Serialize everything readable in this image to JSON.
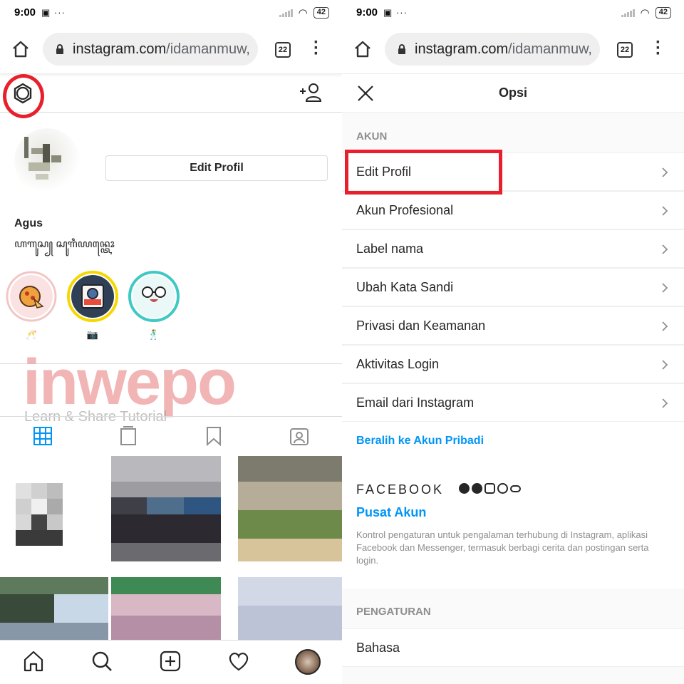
{
  "status_bar": {
    "time": "9:00",
    "battery": "42"
  },
  "browser": {
    "url_main": "instagram.com",
    "url_path": "/idamanmuw,",
    "tab_count": "22"
  },
  "profile": {
    "edit_button": "Edit Profil",
    "username": "Agus",
    "bio": "ꦲꦒꦸꦱ꧀ ꦱꦸꦒꦶꦪꦤ꧀ꦠꦺꦴ",
    "highlights": [
      {
        "label": "🥂",
        "ring": "#f3c6c6",
        "icon": "pizza-icon"
      },
      {
        "label": "📷",
        "ring": "#f5d800",
        "icon": "camera-icon"
      },
      {
        "label": "🕺",
        "ring": "#3fc9c4",
        "icon": "glasses-face-icon"
      }
    ]
  },
  "watermark": {
    "brand": "inwepo",
    "tagline": "Learn & Share Tutorial"
  },
  "options": {
    "title": "Opsi",
    "section_account": "AKUN",
    "account_items": [
      "Edit Profil",
      "Akun Profesional",
      "Label nama",
      "Ubah Kata Sandi",
      "Privasi dan Keamanan",
      "Aktivitas Login",
      "Email dari Instagram"
    ],
    "switch_link": "Beralih ke Akun Pribadi",
    "facebook_word": "FACEBOOK",
    "accounts_center": "Pusat Akun",
    "accounts_center_desc": "Kontrol pengaturan untuk pengalaman terhubung di Instagram, aplikasi Facebook dan Messenger, termasuk berbagi cerita dan postingan serta login.",
    "section_settings": "PENGATURAN",
    "settings_items": [
      "Bahasa"
    ]
  },
  "colors": {
    "accent": "#0095f6",
    "highlight_annotation": "#e8202e"
  }
}
